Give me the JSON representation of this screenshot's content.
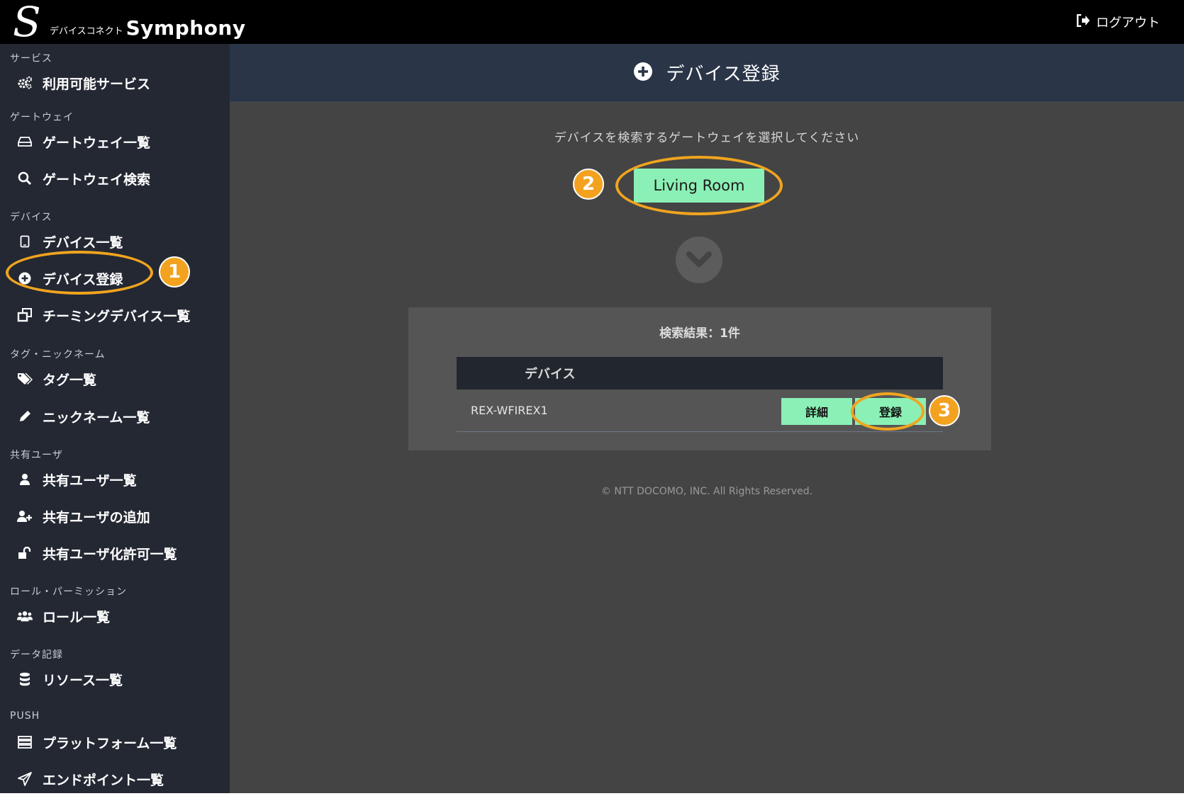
{
  "app": {
    "logo_sub": "デバイスコネクト",
    "logo_name": "Symphony",
    "logout_label": "ログアウト"
  },
  "sidebar": {
    "sections": [
      {
        "title": "サービス",
        "items": [
          {
            "label": "利用可能サービス",
            "icon": "cogs-icon"
          }
        ]
      },
      {
        "title": "ゲートウェイ",
        "items": [
          {
            "label": "ゲートウェイ一覧",
            "icon": "hdd-icon"
          },
          {
            "label": "ゲートウェイ検索",
            "icon": "search-icon"
          }
        ]
      },
      {
        "title": "デバイス",
        "items": [
          {
            "label": "デバイス一覧",
            "icon": "tablet-icon"
          },
          {
            "label": "デバイス登録",
            "icon": "plus-circle-icon"
          },
          {
            "label": "チーミングデバイス一覧",
            "icon": "clone-icon"
          }
        ]
      },
      {
        "title": "タグ・ニックネーム",
        "items": [
          {
            "label": "タグ一覧",
            "icon": "tags-icon"
          },
          {
            "label": "ニックネーム一覧",
            "icon": "pencil-icon"
          }
        ]
      },
      {
        "title": "共有ユーザ",
        "items": [
          {
            "label": "共有ユーザ一覧",
            "icon": "user-icon"
          },
          {
            "label": "共有ユーザの追加",
            "icon": "user-plus-icon"
          },
          {
            "label": "共有ユーザ化許可一覧",
            "icon": "unlock-icon"
          }
        ]
      },
      {
        "title": "ロール・パーミッション",
        "items": [
          {
            "label": "ロール一覧",
            "icon": "users-icon"
          }
        ]
      },
      {
        "title": "データ記録",
        "items": [
          {
            "label": "リソース一覧",
            "icon": "database-icon"
          }
        ]
      },
      {
        "title": "PUSH",
        "items": [
          {
            "label": "プラットフォーム一覧",
            "icon": "server-icon"
          },
          {
            "label": "エンドポイント一覧",
            "icon": "paper-plane-icon"
          }
        ]
      }
    ]
  },
  "header": {
    "title": "デバイス登録",
    "icon": "plus-circle-icon"
  },
  "main": {
    "instruction": "デバイスを検索するゲートウェイを選択してください",
    "gateway_button": "Living Room",
    "results_title": "検索結果：1件",
    "table": {
      "columns": [
        "デバイス"
      ],
      "rows": [
        {
          "device": "REX-WFIREX1",
          "detail_label": "詳細",
          "register_label": "登録"
        }
      ]
    },
    "footer": "© NTT DOCOMO, INC. All Rights Reserved."
  },
  "annotations": {
    "badges": [
      "1",
      "2",
      "3"
    ],
    "color": "#f0a41e"
  }
}
